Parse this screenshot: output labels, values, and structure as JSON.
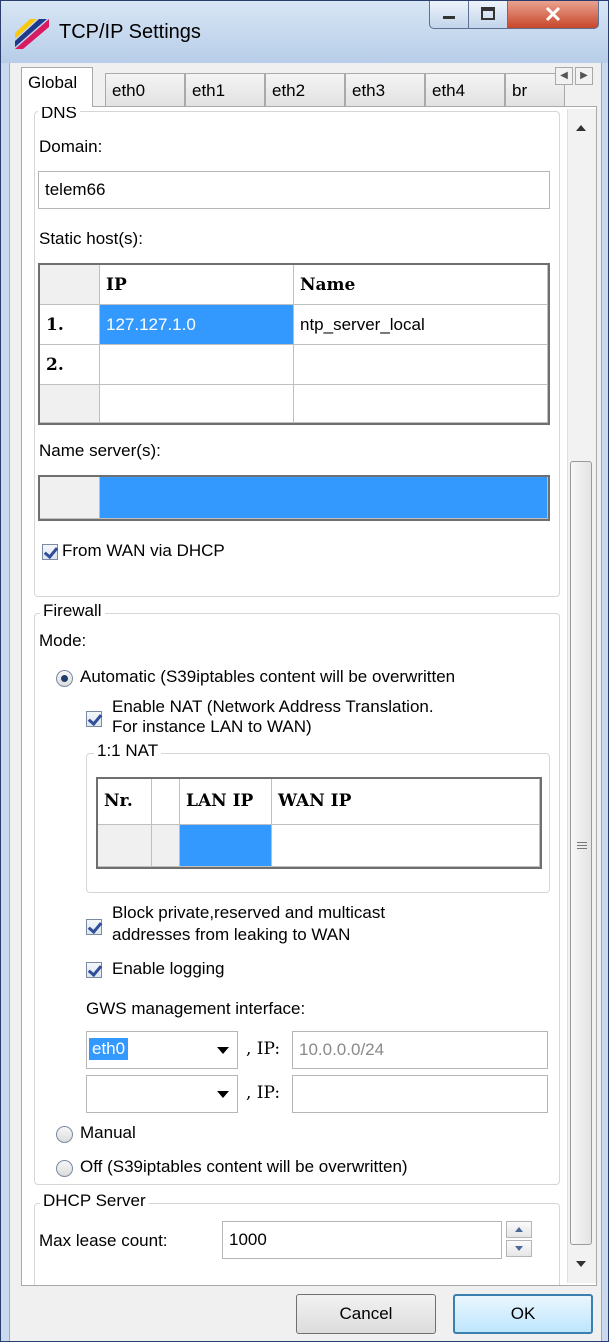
{
  "window": {
    "title": "TCP/IP Settings"
  },
  "tabs": [
    "Global",
    "eth0",
    "eth1",
    "eth2",
    "eth3",
    "eth4",
    "br"
  ],
  "dns": {
    "legend": "DNS",
    "domain_label": "Domain:",
    "domain_value": "telem66",
    "static_hosts_label": "Static host(s):",
    "hosts_headers": {
      "ip": "IP",
      "name": "Name"
    },
    "hosts_rows": [
      {
        "num": "1.",
        "ip": "127.127.1.0",
        "name": "ntp_server_local"
      },
      {
        "num": "2.",
        "ip": "",
        "name": ""
      },
      {
        "num": "",
        "ip": "",
        "name": ""
      }
    ],
    "name_servers_label": "Name server(s):",
    "from_wan_label": "From WAN via DHCP"
  },
  "firewall": {
    "legend": "Firewall",
    "mode_label": "Mode:",
    "automatic_label": "Automatic (S39iptables content will be overwritten",
    "enable_nat_label_1": "Enable NAT (Network Address Translation.",
    "enable_nat_label_2": "For instance LAN to WAN)",
    "nat_legend": "1:1 NAT",
    "nat_headers": {
      "nr": "Nr.",
      "lan_ip": "LAN IP",
      "wan_ip": "WAN IP"
    },
    "block_label_1": "Block private,reserved and multicast",
    "block_label_2": "addresses from leaking to WAN",
    "enable_logging_label": "Enable logging",
    "gws_label": "GWS management interface:",
    "gws_rows": [
      {
        "iface": "eth0",
        "ip_label": ", IP:",
        "ip_value": "10.0.0.0/24"
      },
      {
        "iface": "",
        "ip_label": ", IP:",
        "ip_value": ""
      }
    ],
    "manual_label": "Manual",
    "off_label": "Off (S39iptables content will be overwritten)"
  },
  "dhcp": {
    "legend": "DHCP Server",
    "max_lease_label": "Max lease count:",
    "max_lease_value": "1000"
  },
  "buttons": {
    "cancel": "Cancel",
    "ok": "OK"
  },
  "colors": {
    "selection": "#3399ff",
    "title_bar": "#c9d9ee"
  }
}
